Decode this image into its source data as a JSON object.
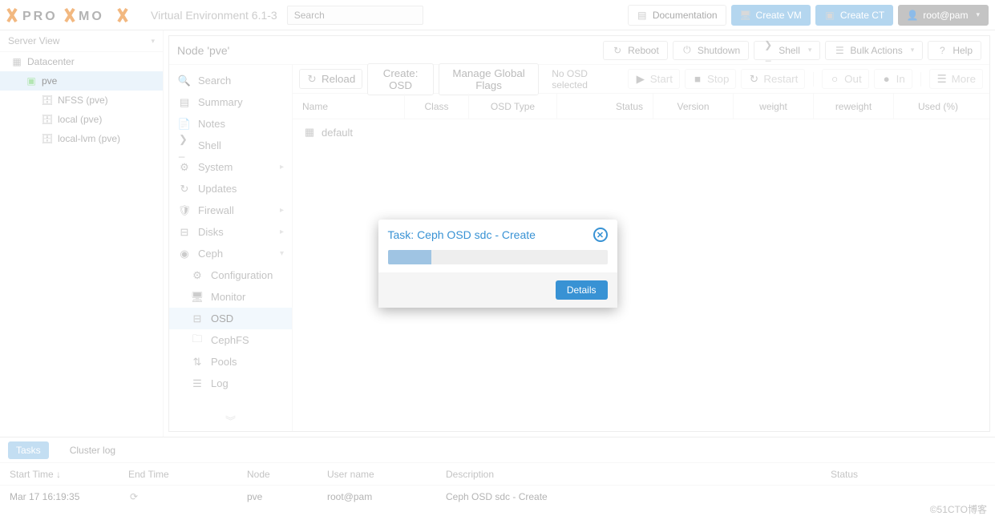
{
  "header": {
    "version": "Virtual Environment 6.1-3",
    "search_placeholder": "Search",
    "doc": "Documentation",
    "create_vm": "Create VM",
    "create_ct": "Create CT",
    "user": "root@pam"
  },
  "tree": {
    "view": "Server View",
    "root": "Datacenter",
    "node": "pve",
    "storages": [
      "NFSS (pve)",
      "local (pve)",
      "local-lvm (pve)"
    ]
  },
  "crumb": {
    "title": "Node 'pve'",
    "reboot": "Reboot",
    "shutdown": "Shutdown",
    "shell": "Shell",
    "bulk": "Bulk Actions",
    "help": "Help"
  },
  "menu": {
    "search": "Search",
    "summary": "Summary",
    "notes": "Notes",
    "shell": "Shell",
    "system": "System",
    "updates": "Updates",
    "firewall": "Firewall",
    "disks": "Disks",
    "ceph": "Ceph",
    "config": "Configuration",
    "monitor": "Monitor",
    "osd": "OSD",
    "cephfs": "CephFS",
    "pools": "Pools",
    "log": "Log"
  },
  "toolbar": {
    "reload": "Reload",
    "create_osd": "Create: OSD",
    "flags": "Manage Global Flags",
    "nosel": "No OSD selected",
    "start": "Start",
    "stop": "Stop",
    "restart": "Restart",
    "out": "Out",
    "in": "In",
    "more": "More"
  },
  "table": {
    "cols": [
      "Name",
      "Class",
      "OSD Type",
      "Status",
      "Version",
      "weight",
      "reweight",
      "Used (%)"
    ],
    "row0": "default"
  },
  "log": {
    "tasks": "Tasks",
    "cluster": "Cluster log",
    "cols": [
      "Start Time",
      "End Time",
      "Node",
      "User name",
      "Description",
      "Status"
    ],
    "row": {
      "start": "Mar 17 16:19:35",
      "end": "",
      "node": "pve",
      "user": "root@pam",
      "desc": "Ceph OSD sdc - Create",
      "status": ""
    },
    "sort_arrow": "↓"
  },
  "dialog": {
    "title": "Task: Ceph OSD sdc - Create",
    "details": "Details"
  },
  "watermark": "©51CTO博客"
}
